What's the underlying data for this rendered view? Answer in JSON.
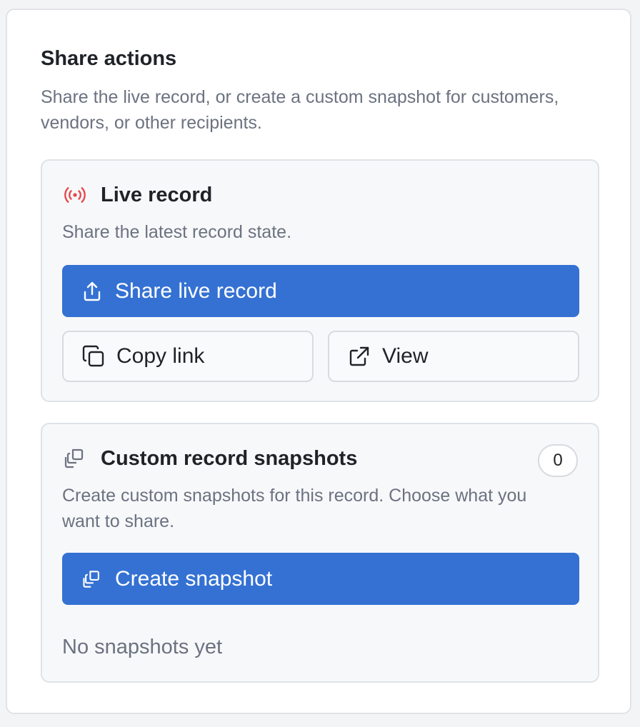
{
  "panel": {
    "title": "Share actions",
    "description": "Share the live record, or create a custom snapshot for customers, vendors, or other recipients."
  },
  "live_record": {
    "icon": "broadcast-icon",
    "icon_color": "#e5484d",
    "title": "Live record",
    "description": "Share the latest record state.",
    "share_button": {
      "label": "Share live record",
      "icon": "share-upload-icon"
    },
    "copy_button": {
      "label": "Copy link",
      "icon": "copy-icon"
    },
    "view_button": {
      "label": "View",
      "icon": "external-link-icon"
    }
  },
  "snapshots": {
    "icon": "snapshots-icon",
    "title": "Custom record snapshots",
    "count": "0",
    "description": "Create custom snapshots for this record. Choose what you want to share.",
    "create_button": {
      "label": "Create snapshot",
      "icon": "snapshots-icon"
    },
    "empty_text": "No snapshots yet"
  },
  "colors": {
    "primary": "#3471d3",
    "muted_text": "#6b7280",
    "heading_text": "#1f2328"
  }
}
